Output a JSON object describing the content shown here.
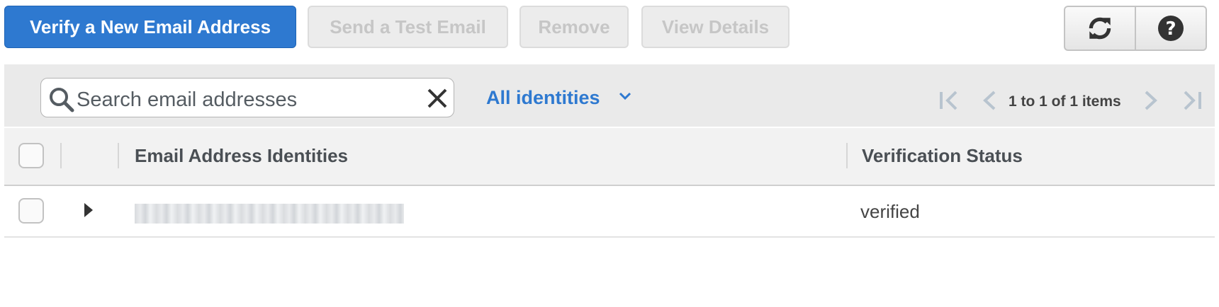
{
  "toolbar": {
    "verify_label": "Verify a New Email Address",
    "send_test_label": "Send a Test Email",
    "remove_label": "Remove",
    "view_details_label": "View Details",
    "refresh_icon": "refresh-icon",
    "help_icon": "help-icon"
  },
  "filter": {
    "search_placeholder": "Search email addresses",
    "identity_filter": "All identities",
    "pagination": "1 to 1 of 1 items"
  },
  "table": {
    "columns": [
      "Email Address Identities",
      "Verification Status"
    ],
    "rows": [
      {
        "email": "",
        "status": "verified"
      }
    ]
  },
  "colors": {
    "primary": "#2e79d0",
    "disabled_text": "#c6c6c6",
    "filter_bar": "#eaeaea"
  }
}
